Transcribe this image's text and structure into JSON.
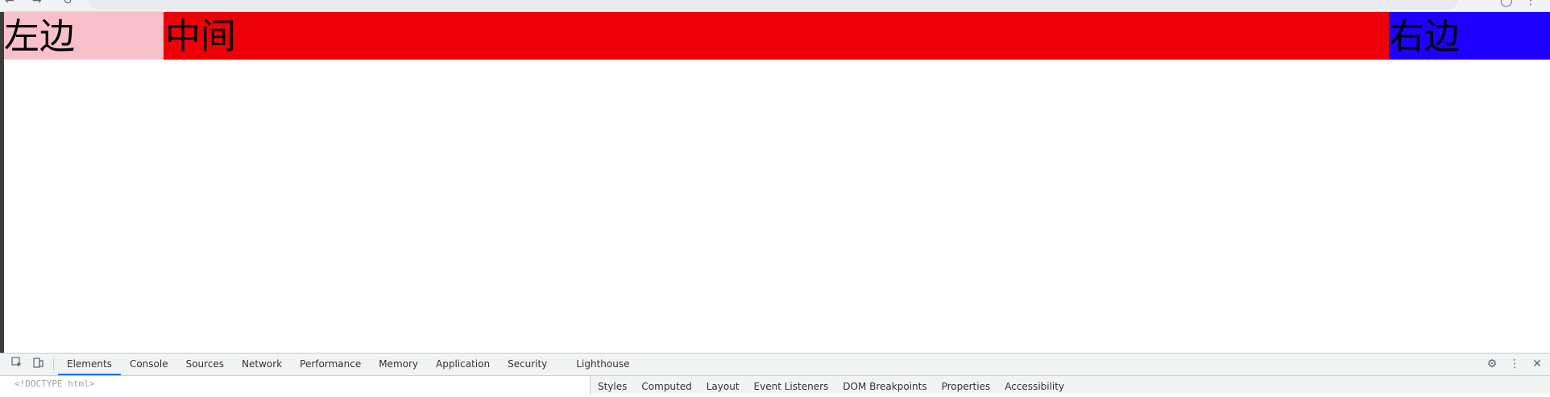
{
  "page": {
    "boxes": [
      {
        "label": "左边",
        "color": "#f8c0cb"
      },
      {
        "label": "中间",
        "color": "#ee0009"
      },
      {
        "label": "右边",
        "color": "#1f00ff"
      }
    ]
  },
  "devtools": {
    "tabs": [
      {
        "label": "Elements",
        "active": true
      },
      {
        "label": "Console"
      },
      {
        "label": "Sources"
      },
      {
        "label": "Network"
      },
      {
        "label": "Performance"
      },
      {
        "label": "Memory"
      },
      {
        "label": "Application"
      },
      {
        "label": "Security"
      },
      {
        "label": "Lighthouse"
      }
    ],
    "doctype": "<!DOCTYPE html>",
    "side_tabs": [
      {
        "label": "Styles"
      },
      {
        "label": "Computed"
      },
      {
        "label": "Layout"
      },
      {
        "label": "Event Listeners"
      },
      {
        "label": "DOM Breakpoints"
      },
      {
        "label": "Properties"
      },
      {
        "label": "Accessibility"
      }
    ],
    "icons": [
      "inspect-icon",
      "device-toggle-icon",
      "settings-icon",
      "more-icon",
      "close-icon"
    ],
    "accent_color": "#1a73e8"
  }
}
